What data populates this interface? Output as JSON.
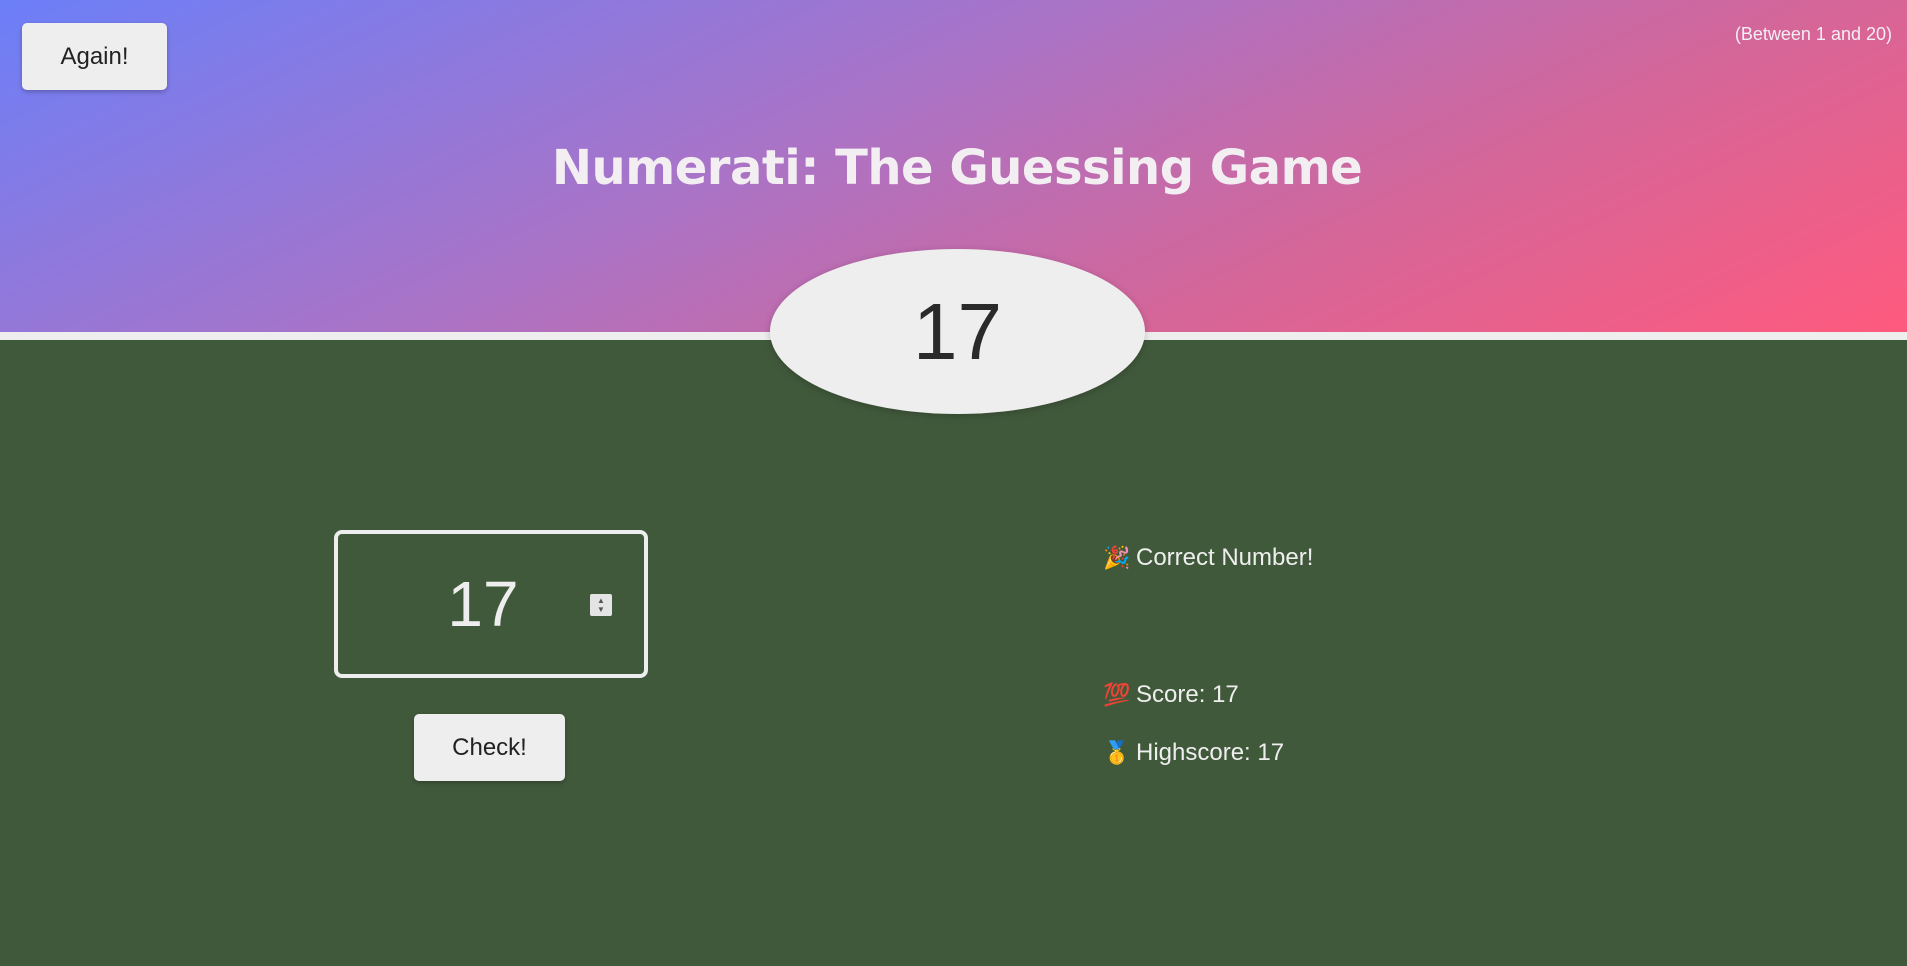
{
  "header": {
    "again_label": "Again!",
    "range_hint": "(Between 1 and 20)",
    "title": "Numerati: The Guessing Game",
    "secret_number": "17",
    "gradient_colors": [
      "#6c7ff8",
      "#a774c9",
      "#d46699",
      "#ff5a7e"
    ]
  },
  "game": {
    "guess_value": "17",
    "check_label": "Check!",
    "message_emoji": "🎉",
    "message": "Correct Number!",
    "score_emoji": "💯",
    "score_text": "Score: 17",
    "highscore_emoji": "🥇",
    "highscore_text": "Highscore: 17",
    "background_color": "#41593b"
  },
  "icons": {
    "spinner_up": "▲",
    "spinner_down": "▼"
  }
}
